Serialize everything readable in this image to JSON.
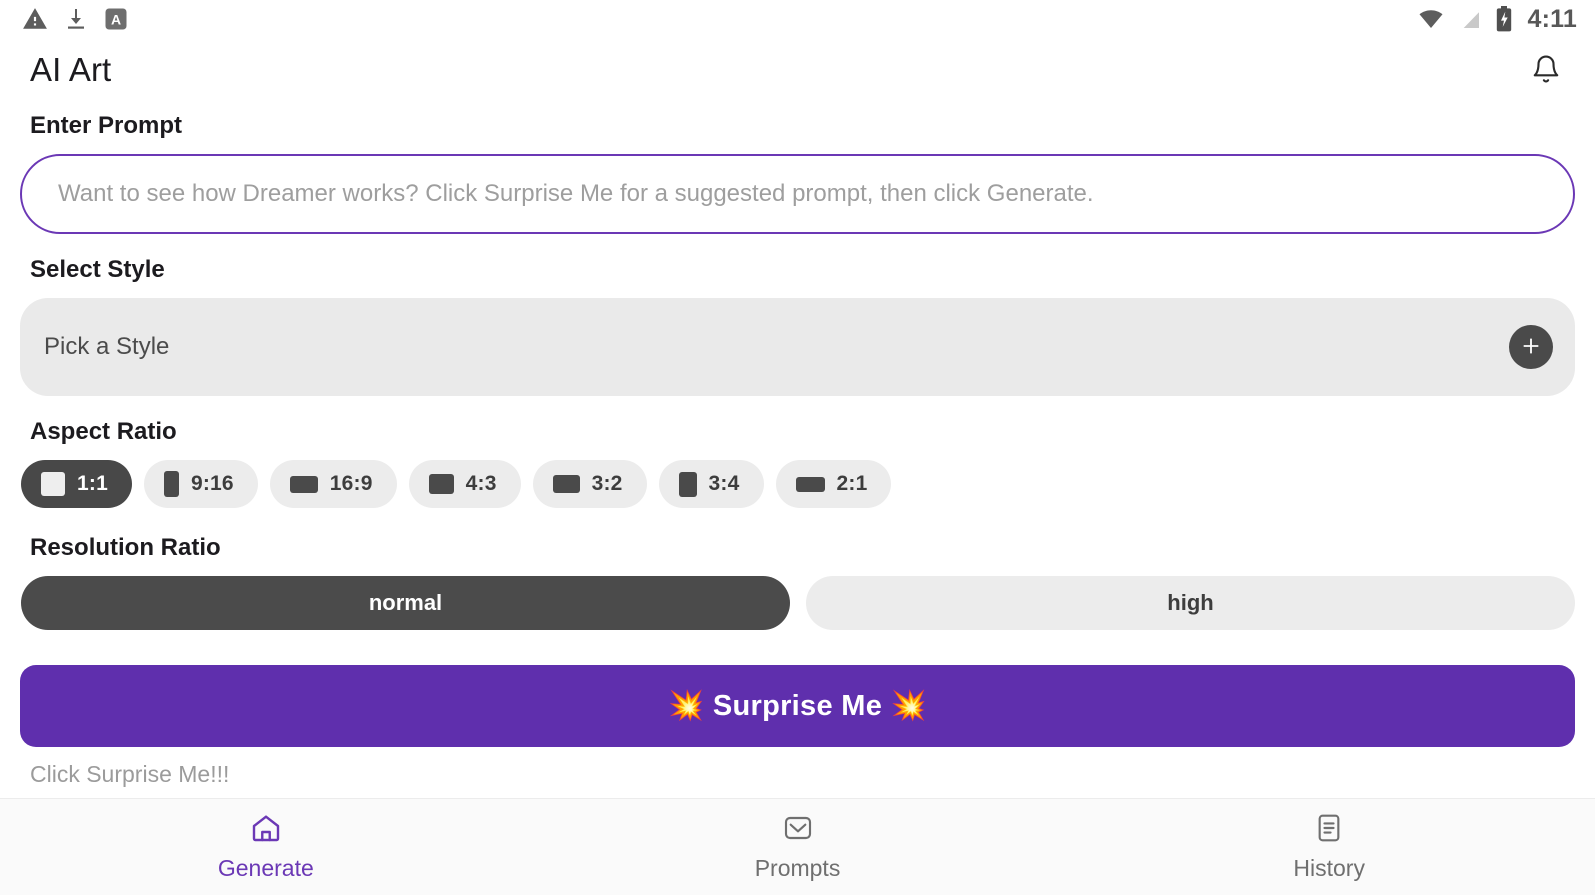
{
  "status_bar": {
    "icons": [
      "warning-triangle-icon",
      "download-icon",
      "app-letter-a-icon"
    ],
    "right_icons": [
      "wifi-icon",
      "no-signal-icon",
      "battery-charging-icon"
    ],
    "time": "4:11"
  },
  "app_bar": {
    "title": "AI Art",
    "notification_icon": "bell-icon"
  },
  "prompt": {
    "label": "Enter Prompt",
    "value": "",
    "placeholder": "Want to see how Dreamer works? Click Surprise Me for a suggested prompt, then click Generate."
  },
  "style": {
    "label": "Select Style",
    "placeholder": "Pick a Style",
    "add_icon": "plus-icon"
  },
  "aspect_ratio": {
    "label": "Aspect Ratio",
    "selected": "1:1",
    "options": [
      {
        "label": "1:1",
        "glyph": "square-icon",
        "selected": true
      },
      {
        "label": "9:16",
        "glyph": "portrait-tall-icon",
        "selected": false
      },
      {
        "label": "16:9",
        "glyph": "landscape-wide-icon",
        "selected": false
      },
      {
        "label": "4:3",
        "glyph": "landscape-icon",
        "selected": false
      },
      {
        "label": "3:2",
        "glyph": "landscape-icon",
        "selected": false
      },
      {
        "label": "3:4",
        "glyph": "portrait-icon",
        "selected": false
      },
      {
        "label": "2:1",
        "glyph": "landscape-ultrawide-icon",
        "selected": false
      }
    ]
  },
  "resolution": {
    "label": "Resolution Ratio",
    "selected": "normal",
    "options": [
      {
        "label": "normal",
        "selected": true
      },
      {
        "label": "high",
        "selected": false
      }
    ]
  },
  "surprise": {
    "label": "💥 Surprise Me 💥"
  },
  "status_message": "Click Surprise Me!!!",
  "bottom_nav": {
    "items": [
      {
        "label": "Generate",
        "icon": "home-icon",
        "active": true
      },
      {
        "label": "Prompts",
        "icon": "inbox-icon",
        "active": false
      },
      {
        "label": "History",
        "icon": "document-icon",
        "active": false
      }
    ]
  },
  "colors": {
    "accent": "#6b38b5",
    "button": "#5f2fad",
    "chip_selected": "#484848",
    "chip_idle": "#ececec"
  }
}
